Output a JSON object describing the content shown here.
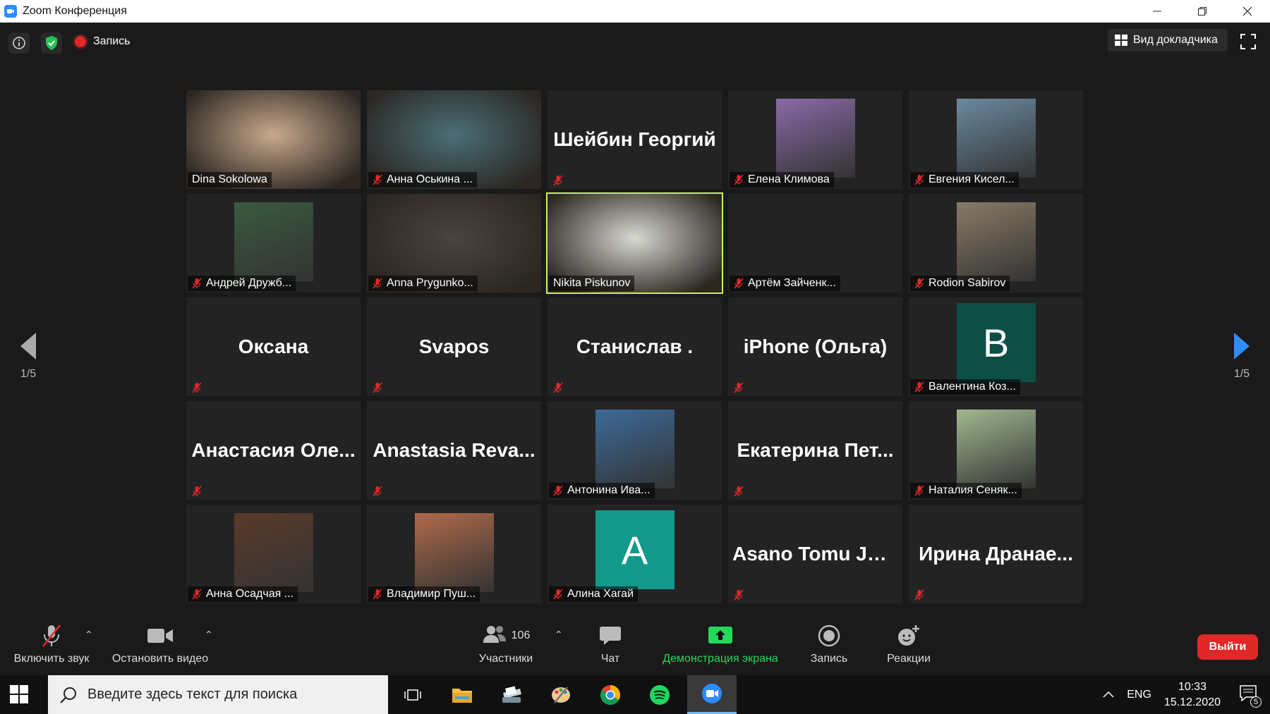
{
  "window": {
    "title": "Zoom Конференция"
  },
  "topbar": {
    "recording_label": "Запись",
    "speaker_view_label": "Вид докладчика"
  },
  "gallery": {
    "page_left": "1/5",
    "page_right": "1/5",
    "tiles": [
      {
        "label": "Dina Sokolowa",
        "muted": false,
        "kind": "video",
        "color": "#c9a98c"
      },
      {
        "label": "Анна Оськина ...",
        "muted": true,
        "kind": "video",
        "color": "#4a6f77"
      },
      {
        "label": "",
        "big": "Шейбин Георгий",
        "muted": true,
        "kind": "name"
      },
      {
        "label": "Елена Климова",
        "muted": true,
        "kind": "photo",
        "color": "#8a6aa8"
      },
      {
        "label": "Евгения Кисел...",
        "muted": true,
        "kind": "photo",
        "color": "#6a8aa0"
      },
      {
        "label": "Андрей Дружб...",
        "muted": true,
        "kind": "photo",
        "color": "#3a5a3e"
      },
      {
        "label": "Anna Prygunko...",
        "muted": true,
        "kind": "video",
        "color": "#4a4440"
      },
      {
        "label": "Nikita Piskunov",
        "muted": false,
        "kind": "video",
        "color": "#d8d8d2",
        "active": true
      },
      {
        "label": "Артём Зайченк...",
        "muted": true,
        "kind": "empty"
      },
      {
        "label": "Rodion Sabirov",
        "muted": true,
        "kind": "photo",
        "color": "#8a7a66"
      },
      {
        "label": "",
        "big": "Оксана",
        "muted": true,
        "kind": "name"
      },
      {
        "label": "",
        "big": "Svapos",
        "muted": true,
        "kind": "name"
      },
      {
        "label": "",
        "big": "Станислав .",
        "muted": true,
        "kind": "name"
      },
      {
        "label": "",
        "big": "iPhone (Ольга)",
        "muted": true,
        "kind": "name"
      },
      {
        "label": "Валентина Коз...",
        "muted": true,
        "kind": "letter",
        "letter": "B",
        "color": "#0d4f45"
      },
      {
        "label": "",
        "big": "Анастасия  Оле...",
        "muted": true,
        "kind": "name"
      },
      {
        "label": "",
        "big": "Anastasia  Reva...",
        "muted": true,
        "kind": "name"
      },
      {
        "label": "Антонина Ива...",
        "muted": true,
        "kind": "photo",
        "color": "#3c6a9a"
      },
      {
        "label": "",
        "big": "Екатерина  Пет...",
        "muted": true,
        "kind": "name"
      },
      {
        "label": "Наталия Сеняк...",
        "muted": true,
        "kind": "photo",
        "color": "#a0b890"
      },
      {
        "label": "Анна Осадчая ...",
        "muted": true,
        "kind": "photo",
        "color": "#5a3a2a"
      },
      {
        "label": "Владимир Пуш...",
        "muted": true,
        "kind": "photo",
        "color": "#b06a4a"
      },
      {
        "label": "Алина Хагай",
        "muted": true,
        "kind": "letter",
        "letter": "A",
        "color": "#12998b"
      },
      {
        "label": "",
        "big": "Asano Tomu JREX",
        "muted": true,
        "kind": "name"
      },
      {
        "label": "",
        "big": "Ирина  Дранае...",
        "muted": true,
        "kind": "name"
      }
    ]
  },
  "toolbar": {
    "unmute_label": "Включить звук",
    "stop_video_label": "Остановить видео",
    "participants_label": "Участники",
    "participants_count": "106",
    "chat_label": "Чат",
    "share_label": "Демонстрация экрана",
    "record_label": "Запись",
    "reactions_label": "Реакции",
    "leave_label": "Выйти",
    "share_color": "#23d959"
  },
  "taskbar": {
    "search_placeholder": "Введите здесь текст для поиска",
    "lang": "ENG",
    "time": "10:33",
    "date": "15.12.2020",
    "notification_count": "5"
  }
}
